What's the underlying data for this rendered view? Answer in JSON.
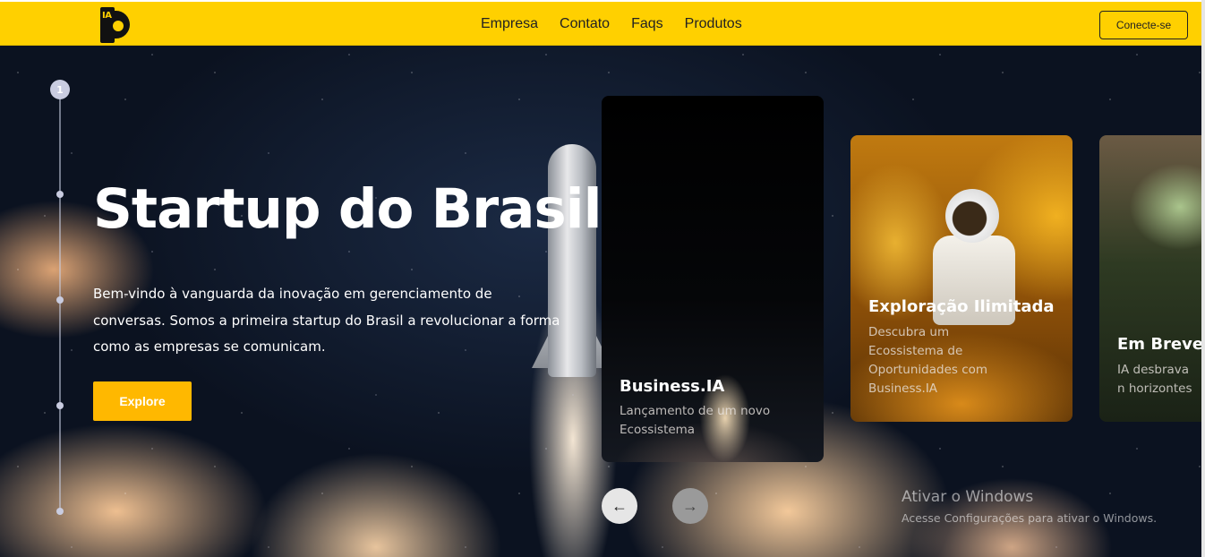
{
  "header": {
    "logo_text": "IA",
    "nav": [
      "Empresa",
      "Contato",
      "Faqs",
      "Produtos"
    ],
    "connect_label": "Conecte-se"
  },
  "hero": {
    "step_current": "1",
    "title": "Startup do Brasil",
    "paragraph": "Bem-vindo à vanguarda da inovação em gerenciamento de conversas. Somos a primeira startup do Brasil a revolucionar a forma como as empresas se comunicam.",
    "explore_label": "Explore"
  },
  "cards": [
    {
      "title": "Business.IA",
      "subtitle": "Lançamento de um novo Ecossistema"
    },
    {
      "title": "Exploração Ilimitada",
      "subtitle": "Descubra um Ecossistema de Oportunidades com Business.IA"
    },
    {
      "title": "Em Breve",
      "subtitle": "IA desbrava n horizontes"
    }
  ],
  "carousel": {
    "prev_icon": "arrow-left-icon",
    "next_icon": "arrow-right-icon"
  },
  "windows_watermark": {
    "line1": "Ativar o Windows",
    "line2": "Acesse Configurações para ativar o Windows."
  },
  "colors": {
    "accent": "#ffd000",
    "button": "#ffb800"
  }
}
